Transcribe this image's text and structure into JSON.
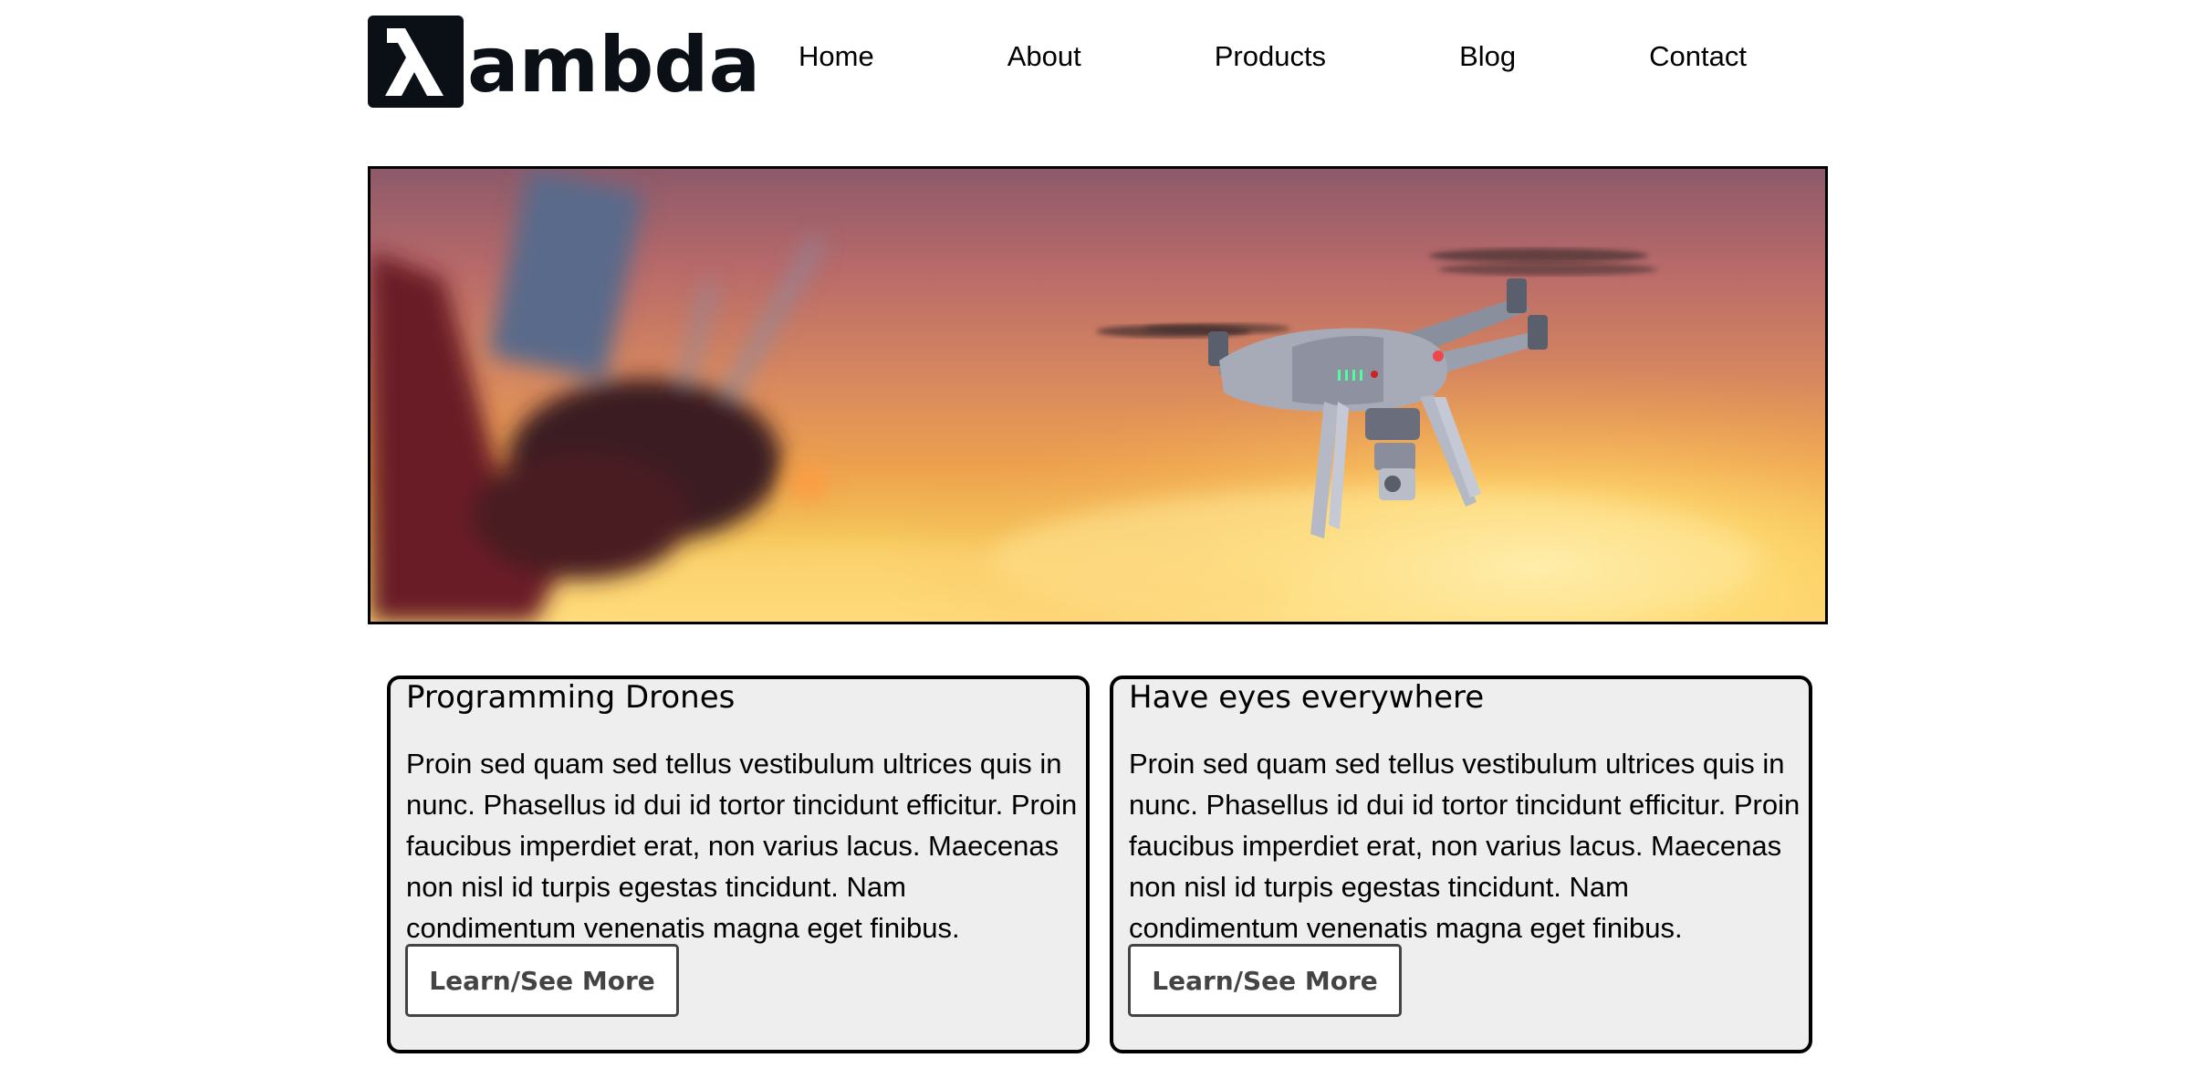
{
  "header": {
    "logo_text": "ambda",
    "logo_glyph": "λ",
    "nav": {
      "home": "Home",
      "about": "About",
      "products": "Products",
      "blog": "Blog",
      "contact": "Contact"
    }
  },
  "hero": {
    "image": "drone-flying-at-sunset-photo"
  },
  "cards": [
    {
      "title": "Programming Drones",
      "body": "Proin sed quam sed tellus vestibulum ultrices quis in nunc. Phasellus id dui id tortor tincidunt efficitur. Proin faucibus imperdiet erat, non varius lacus. Maecenas non nisl id turpis egestas tincidunt. Nam condimentum venenatis magna eget finibus.",
      "button_label": "Learn/See More"
    },
    {
      "title": "Have eyes everywhere",
      "body": "Proin sed quam sed tellus vestibulum ultrices quis in nunc. Phasellus id dui id tortor tincidunt efficitur. Proin faucibus imperdiet erat, non varius lacus. Maecenas non nisl id turpis egestas tincidunt. Nam condimentum venenatis magna eget finibus.",
      "button_label": "Learn/See More"
    }
  ],
  "colors": {
    "logo": "#0b0f16",
    "card_bg": "#eeeeee",
    "button_border": "#444444"
  }
}
